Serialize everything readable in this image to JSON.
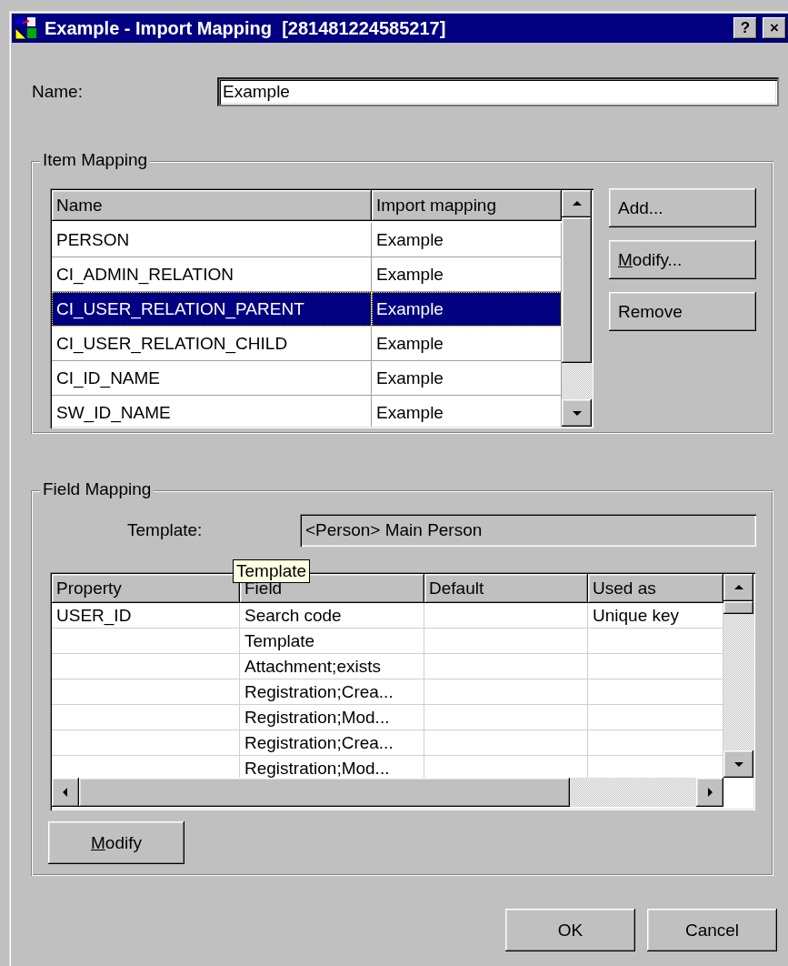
{
  "window": {
    "title": "Example - Import Mapping  [281481224585217]",
    "help": "?",
    "close": "×"
  },
  "name": {
    "label": "Name:",
    "value": "Example"
  },
  "item_mapping": {
    "title": "Item Mapping",
    "columns": [
      "Name",
      "Import mapping"
    ],
    "rows": [
      {
        "name": "PERSON",
        "import_mapping": "Example",
        "selected": false
      },
      {
        "name": "CI_ADMIN_RELATION",
        "import_mapping": "Example",
        "selected": false
      },
      {
        "name": "CI_USER_RELATION_PARENT",
        "import_mapping": "Example",
        "selected": true
      },
      {
        "name": "CI_USER_RELATION_CHILD",
        "import_mapping": "Example",
        "selected": false
      },
      {
        "name": "CI_ID_NAME",
        "import_mapping": "Example",
        "selected": false
      },
      {
        "name": "SW_ID_NAME",
        "import_mapping": "Example",
        "selected": false
      }
    ],
    "buttons": [
      {
        "label": "Add...",
        "mnemonic": false
      },
      {
        "label": "Modify...",
        "mnemonic": true
      },
      {
        "label": "Remove",
        "mnemonic": false
      }
    ]
  },
  "field_mapping": {
    "title": "Field Mapping",
    "template_label": "Template:",
    "template_value": "<Person> Main Person",
    "columns": [
      "Property",
      "Field",
      "Default",
      "Used as"
    ],
    "tooltip": "Template",
    "rows": [
      [
        "USER_ID",
        "Search code",
        "",
        "Unique key"
      ],
      [
        "",
        "Template",
        "",
        ""
      ],
      [
        "",
        "Attachment;exists",
        "",
        ""
      ],
      [
        "",
        "Registration;Crea...",
        "",
        ""
      ],
      [
        "",
        "Registration;Mod...",
        "",
        ""
      ],
      [
        "",
        "Registration;Crea...",
        "",
        ""
      ],
      [
        "",
        "Registration;Mod...",
        "",
        ""
      ]
    ],
    "button": {
      "label": "Modify",
      "mnemonic": true
    }
  },
  "buttons": [
    {
      "label": "OK",
      "mnemonic": false
    },
    {
      "label": "Cancel",
      "mnemonic": false
    }
  ]
}
